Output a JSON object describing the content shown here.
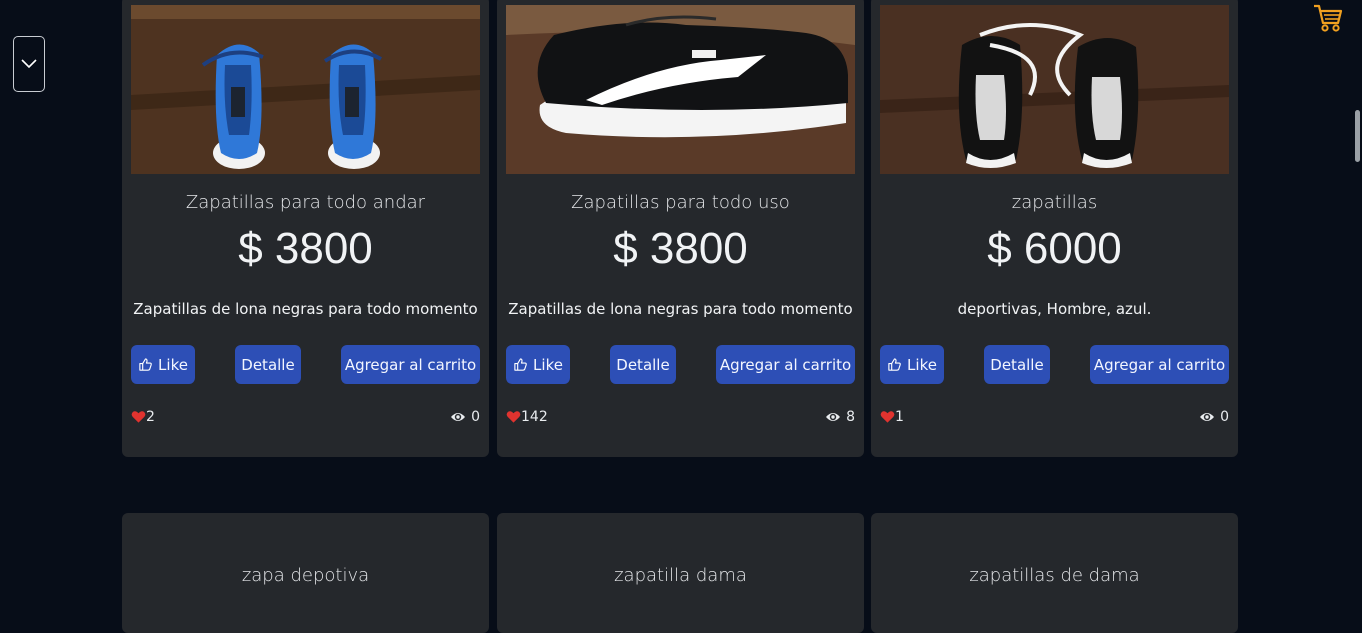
{
  "colors": {
    "background": "#070d18",
    "card": "#25282c",
    "button": "#2d4fb6",
    "cart_icon": "#f0a020",
    "heart": "#e0332f"
  },
  "icons": {
    "dropdown": "chevron-down-icon",
    "cart": "shopping-cart-icon",
    "like": "thumbs-up-icon",
    "likes": "heart-icon",
    "views": "eye-icon"
  },
  "products": [
    {
      "title": "Zapatillas para todo andar",
      "price": "$ 3800",
      "description": "Zapatillas de lona negras para todo momento",
      "like_label": "Like",
      "detail_label": "Detalle",
      "cart_label": "Agregar al carrito",
      "likes": "2",
      "views": "0"
    },
    {
      "title": "Zapatillas para todo uso",
      "price": "$ 3800",
      "description": "Zapatillas de lona negras para todo momento",
      "like_label": "Like",
      "detail_label": "Detalle",
      "cart_label": "Agregar al carrito",
      "likes": "142",
      "views": "8"
    },
    {
      "title": "zapatillas",
      "price": "$ 6000",
      "description": "deportivas, Hombre, azul.",
      "like_label": "Like",
      "detail_label": "Detalle",
      "cart_label": "Agregar al carrito",
      "likes": "1",
      "views": "0"
    },
    {
      "title": "zapa depotiva"
    },
    {
      "title": "zapatilla dama"
    },
    {
      "title": "zapatillas de dama"
    }
  ]
}
